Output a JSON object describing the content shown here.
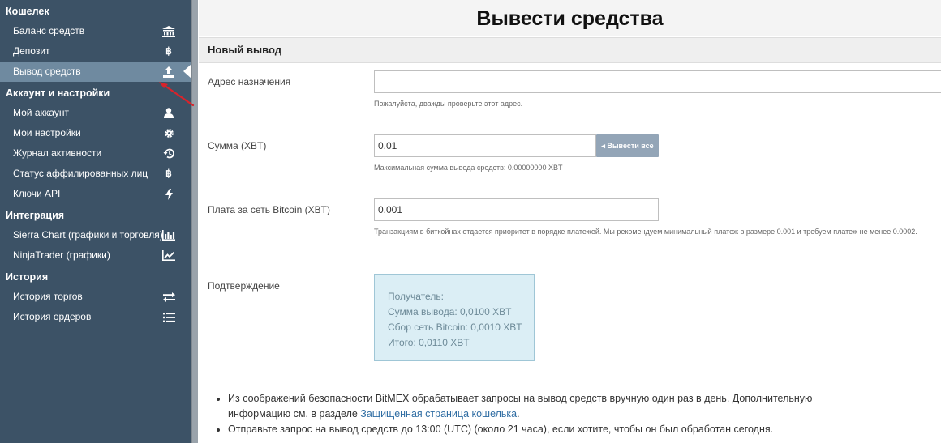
{
  "sidebar": {
    "sections": [
      {
        "title": "Кошелек",
        "items": [
          {
            "label": "Баланс средств",
            "icon": "bank-icon"
          },
          {
            "label": "Депозит",
            "icon": "bitcoin-icon"
          },
          {
            "label": "Вывод средств",
            "icon": "upload-icon",
            "active": true
          }
        ]
      },
      {
        "title": "Аккаунт и настройки",
        "items": [
          {
            "label": "Мой аккаунт",
            "icon": "user-icon"
          },
          {
            "label": "Мои настройки",
            "icon": "gear-icon"
          },
          {
            "label": "Журнал активности",
            "icon": "history-icon"
          },
          {
            "label": "Статус аффилированных лиц",
            "icon": "bitcoin-icon"
          },
          {
            "label": "Ключи API",
            "icon": "bolt-icon"
          }
        ]
      },
      {
        "title": "Интеграция",
        "items": [
          {
            "label": "Sierra Chart (графики и торговля)",
            "icon": "bar-chart-icon"
          },
          {
            "label": "NinjaTrader (графики)",
            "icon": "line-chart-icon"
          }
        ]
      },
      {
        "title": "История",
        "items": [
          {
            "label": "История торгов",
            "icon": "exchange-icon"
          },
          {
            "label": "История ордеров",
            "icon": "list-icon"
          }
        ]
      }
    ]
  },
  "page": {
    "title": "Вывести средства",
    "panel_title": "Новый вывод"
  },
  "form": {
    "address_label": "Адрес назначения",
    "address_value": "",
    "address_hint": "Пожалуйста, дважды проверьте этот адрес.",
    "amount_label": "Сумма (XBT)",
    "amount_value": "0.01",
    "withdraw_all_label": "Вывести все",
    "amount_hint": "Максимальная сумма вывода средств: 0.00000000 XBT",
    "fee_label": "Плата за сеть Bitcoin (XBT)",
    "fee_value": "0.001",
    "fee_hint": "Транзакциям в биткойнах отдается приоритет в порядке платежей.  Мы рекомендуем минимальный платеж в размере 0.001 и требуем платеж не менее 0.0002.",
    "confirm_label": "Подтверждение",
    "confirm_lines": [
      "Получатель:",
      "Сумма вывода: 0,0100 XBT",
      "Сбор сеть Bitcoin: 0,0010 XBT",
      "Итого: 0,0110 XBT"
    ]
  },
  "notes": {
    "note1_text": "Из соображений безопасности BitMEX обрабатывает запросы на вывод средств вручную один раз в день. Дополнительную информацию см. в разделе ",
    "note1_link": "Защищенная страница кошелька",
    "note1_end": ".",
    "note2_text": "Отправьте запрос на вывод средств до 13:00 (UTC) (около 21 часа), если хотите, чтобы он был обработан сегодня."
  },
  "colors": {
    "sidebar_bg": "#3c5266",
    "sidebar_active": "#6f8aa0",
    "confirm_bg": "#dbeef5",
    "link": "#2f6da3",
    "annotation_arrow": "#d9232b"
  }
}
